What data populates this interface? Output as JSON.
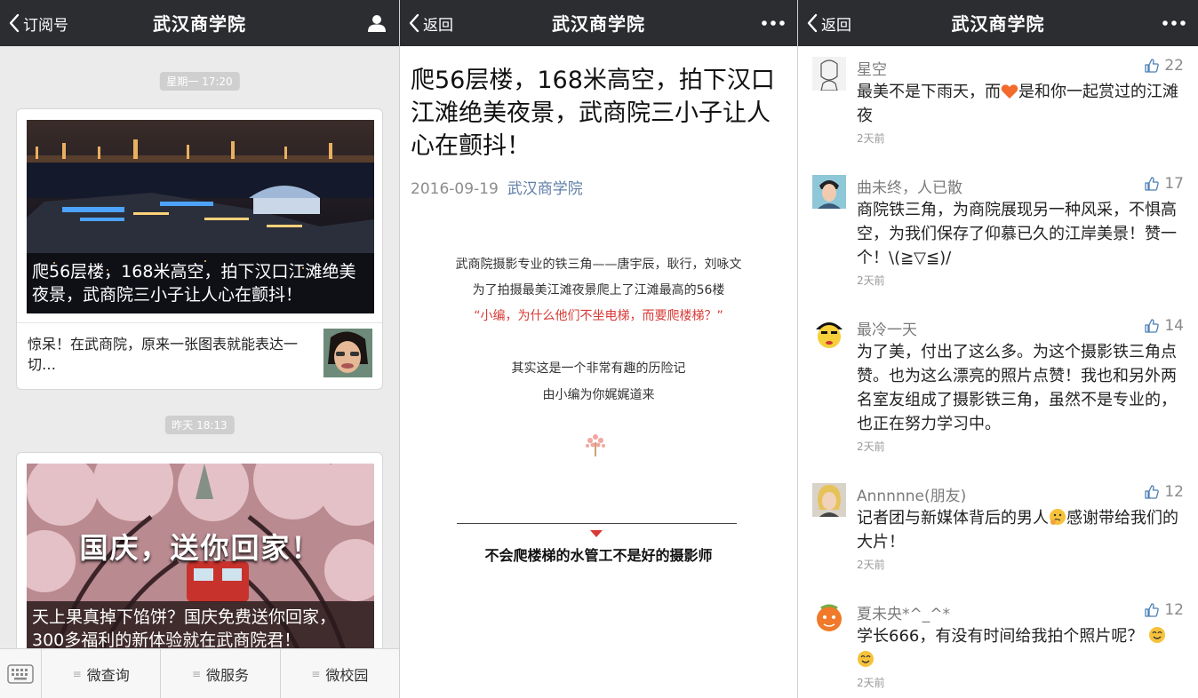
{
  "panel_feed": {
    "nav": {
      "back_label": "订阅号",
      "title": "武汉商学院"
    },
    "time_1": "星期一 17:20",
    "card_1": {
      "hero_title": "爬56层楼，168米高空，拍下汉口江滩绝美夜景，武商院三小子让人心在颤抖！",
      "sub_title": "惊呆！在武商院，原来一张图表就能表达一切…"
    },
    "time_2": "昨天 18:13",
    "card_2": {
      "banner_text": "国庆，送你回家！",
      "hero_title": "天上果真掉下馅饼？国庆免费送你回家，300多福利的新体验就在武商院君！"
    },
    "menu": [
      "微查询",
      "微服务",
      "微校园"
    ]
  },
  "panel_article": {
    "nav": {
      "back_label": "返回",
      "title": "武汉商学院"
    },
    "title": "爬56层楼，168米高空，拍下汉口江滩绝美夜景，武商院三小子让人心在颤抖！",
    "date": "2016-09-19",
    "source": "武汉商学院",
    "lines": [
      "武商院摄影专业的铁三角——唐宇辰，耿行，刘咏文",
      "为了拍摄最美江滩夜景爬上了江滩最高的56楼",
      "“小编，为什么他们不坐电梯，而要爬楼梯？”",
      "其实这是一个非常有趣的历险记",
      "由小编为你娓娓道来"
    ],
    "bold_line": "不会爬楼梯的水管工不是好的摄影师",
    "colors": {
      "red": "#d83a36",
      "link": "#607fa6"
    }
  },
  "panel_comments": {
    "nav": {
      "back_label": "返回",
      "title": "武汉商学院"
    },
    "comments": [
      {
        "name": "星空",
        "likes": "22",
        "text_a": "最美不是下雨天，而",
        "text_b": "是和你一起赏过的江滩夜",
        "time": "2天前"
      },
      {
        "name": "曲未终，人已散",
        "likes": "17",
        "text": "商院铁三角，为商院展现另一种风采，不惧高空，为我们保存了仰慕已久的江岸美景！赞一个！\\(≧▽≦)/",
        "time": "2天前"
      },
      {
        "name": "最冷一天",
        "likes": "14",
        "text": "为了美，付出了这么多。为这个摄影铁三角点赞。也为这么漂亮的照片点赞！我也和另外两名室友组成了摄影铁三角，虽然不是专业的，也正在努力学习中。",
        "time": "2天前"
      },
      {
        "name": "Annnnne(朋友)",
        "likes": "12",
        "text_a": "记者团与新媒体背后的男人",
        "text_b": "感谢带给我们的大片！",
        "time": "2天前"
      },
      {
        "name": "夏未央*^_^*",
        "likes": "12",
        "text_a": "学长666，有没有时间给我拍个照片呢？",
        "time": "2天前"
      }
    ]
  }
}
